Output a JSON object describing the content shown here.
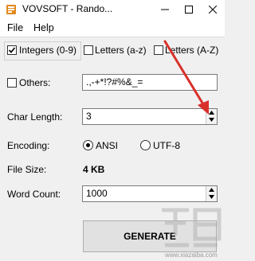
{
  "window": {
    "title": "VOVSOFT - Rando..."
  },
  "menu": {
    "items": [
      "File",
      "Help"
    ]
  },
  "options": {
    "integers": {
      "label": "Integers (0-9)",
      "checked": true
    },
    "letters_lower": {
      "label": "Letters (a-z)",
      "checked": false
    },
    "letters_upper": {
      "label": "Letters (A-Z)",
      "checked": false
    },
    "others": {
      "label": "Others:",
      "checked": false,
      "value": ".,-+*!?#%&_="
    }
  },
  "char_length": {
    "label": "Char Length:",
    "value": "3"
  },
  "encoding": {
    "label": "Encoding:",
    "ansi": "ANSI",
    "utf8": "UTF-8",
    "selected": "ANSI"
  },
  "file_size": {
    "label": "File Size:",
    "value": "4 KB"
  },
  "word_count": {
    "label": "Word Count:",
    "value": "1000"
  },
  "generate": {
    "label": "GENERATE"
  },
  "watermark": {
    "text": "www.xiazaiba.com"
  },
  "colors": {
    "annotation_arrow": "#d9302a",
    "app_icon": "#e08a1e"
  }
}
